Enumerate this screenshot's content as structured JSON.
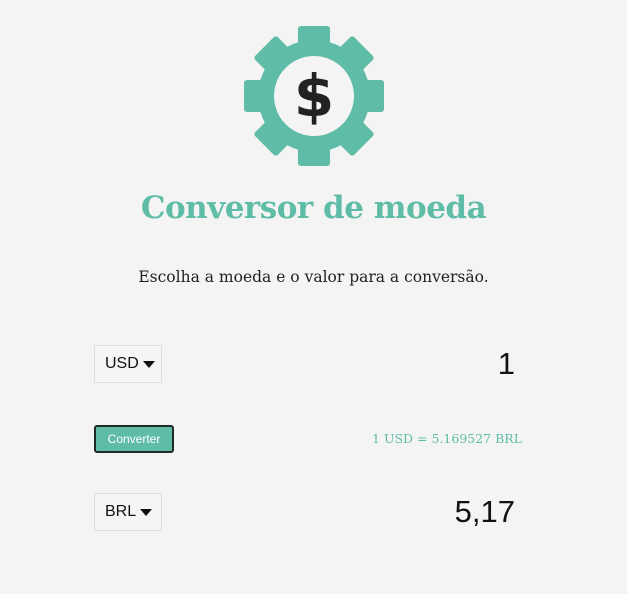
{
  "app": {
    "title": "Conversor de moeda",
    "subtitle": "Escolha a moeda e o valor para a conversão.",
    "logo_icon": "gear-dollar-icon"
  },
  "from": {
    "currency": "USD",
    "amount": "1"
  },
  "convert_button": {
    "label": "Converter"
  },
  "rate_text": "1 USD = 5.169527 BRL",
  "to": {
    "currency": "BRL",
    "amount": "5,17"
  },
  "colors": {
    "accent": "#5fbca6",
    "background": "#f4f4f4",
    "text": "#1f1f1f"
  }
}
